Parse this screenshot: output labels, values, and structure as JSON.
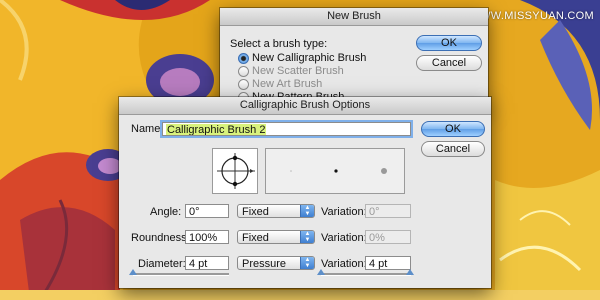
{
  "watermark": "思缘设计论坛 WWW.MISSYUAN.COM",
  "new_brush": {
    "title": "New Brush",
    "prompt": "Select a brush type:",
    "options": [
      {
        "label": "New Calligraphic Brush",
        "selected": true,
        "enabled": true
      },
      {
        "label": "New Scatter Brush",
        "selected": false,
        "enabled": false
      },
      {
        "label": "New Art Brush",
        "selected": false,
        "enabled": false
      },
      {
        "label": "New Pattern Brush",
        "selected": false,
        "enabled": true
      }
    ],
    "ok_label": "OK",
    "cancel_label": "Cancel"
  },
  "calligraphic": {
    "title": "Calligraphic Brush Options",
    "name_label": "Name:",
    "name_value": "Calligraphic Brush 2",
    "ok_label": "OK",
    "cancel_label": "Cancel",
    "angle": {
      "label": "Angle:",
      "value": "0°",
      "mode": "Fixed",
      "variation_label": "Variation:",
      "variation_value": "0°",
      "variation_enabled": false
    },
    "roundness": {
      "label": "Roundness:",
      "value": "100%",
      "mode": "Fixed",
      "variation_label": "Variation:",
      "variation_value": "0%",
      "variation_enabled": false
    },
    "diameter": {
      "label": "Diameter:",
      "value": "4 pt",
      "mode": "Pressure",
      "variation_label": "Variation:",
      "variation_value": "4 pt",
      "variation_enabled": true
    }
  },
  "colors": {
    "accent": "#5f9ee6",
    "selection_highlight": "#d9f27c"
  }
}
